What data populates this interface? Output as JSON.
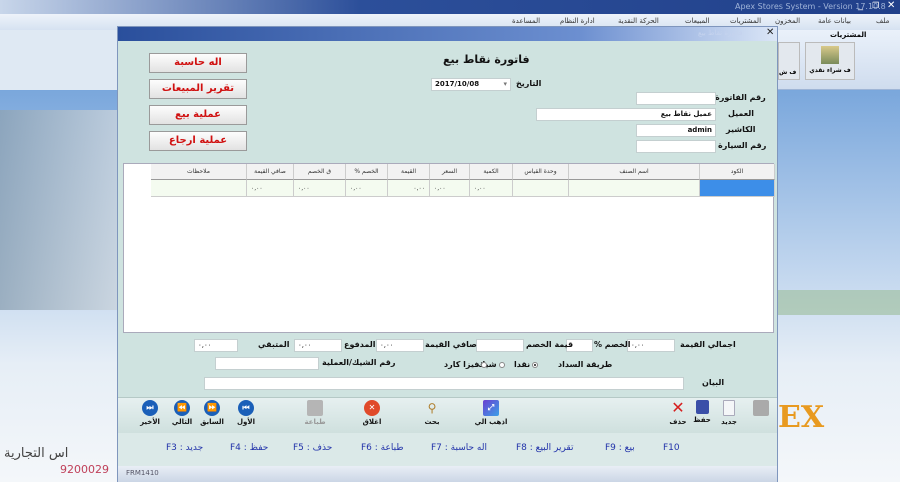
{
  "app": {
    "title": "Apex Stores System - Version 17.10.8",
    "menu": [
      "ملف",
      "بيانات عامة",
      "المخزون",
      "المشتريات",
      "المبيعات",
      "الحركة النقدية",
      "ادارة النظام",
      "المساعدة"
    ],
    "ribbon": {
      "group": "المشتريات",
      "buttons": [
        "ف شراء نقدي",
        "ف ش"
      ]
    }
  },
  "background": {
    "company_text": "اس التجارية",
    "phone": "9200029",
    "logo": "EX"
  },
  "window": {
    "title": "فاتورة نقاط بيع",
    "heading": "فاتورة نقاط بيع",
    "side_buttons": [
      "اله حاسبة",
      "تقرير المبيعات",
      "عملية بيع",
      "عملية ارجاع"
    ],
    "date_label": "التاريخ",
    "date_value": "2017/10/08",
    "fields": [
      {
        "label": "رقم الفاتورة",
        "value": ""
      },
      {
        "label": "العميل",
        "value": "عميل نقاط بيع"
      },
      {
        "label": "الكاشير",
        "value": "admin"
      },
      {
        "label": "رقم السيارة",
        "value": ""
      }
    ],
    "grid": {
      "columns": [
        "الكود",
        "اسم الصنف",
        "وحدة القياس",
        "الكمية",
        "السعر",
        "القيمة",
        "الخصم %",
        "ق الخصم",
        "صافي القيمة",
        "ملاحظات"
      ],
      "row": [
        "",
        "",
        "",
        "٠,٠٠",
        "٠,٠٠",
        "٠,٠٠",
        "٠,٠٠",
        "٠,٠٠",
        "٠,٠٠",
        ""
      ]
    },
    "totals": {
      "total_label": "اجمالي القيمة",
      "total": "٠,٠٠",
      "disc_pct_label": "الخصم %",
      "disc_pct": "",
      "disc_val_label": "قيمة الخصم",
      "disc_val": "",
      "net_label": "صافي القيمة",
      "net": "٠,٠٠",
      "paid_label": "المدفوع",
      "paid": "٠,٠٠",
      "remain_label": "المتبقي",
      "remain": "٠,٠٠"
    },
    "payment": {
      "label": "طريقة السداد",
      "options": [
        "نقدا",
        "شيك",
        "فيزا كارد"
      ],
      "selected": "نقدا",
      "cheque_label": "رقم الشيك/العملية",
      "cheque_value": ""
    },
    "notes": {
      "label": "البيان",
      "value": ""
    },
    "toolbar": {
      "new": "جديد",
      "save": "حفظ",
      "delete": "حذف",
      "goto": "اذهب الي",
      "search": "بحث",
      "close": "اغلاق",
      "print": "طباعة",
      "first": "الأول",
      "prev": "السابق",
      "next": "التالي",
      "last": "الأخير"
    },
    "shortcuts": [
      "F3 : جديد",
      "F4 : حفظ",
      "F5 : حذف",
      "F6 : طباعة",
      "F7 : اله حاسبة",
      "F8 : تقرير البيع",
      "F9 : بيع",
      "F10"
    ],
    "status": "FRM1410"
  }
}
